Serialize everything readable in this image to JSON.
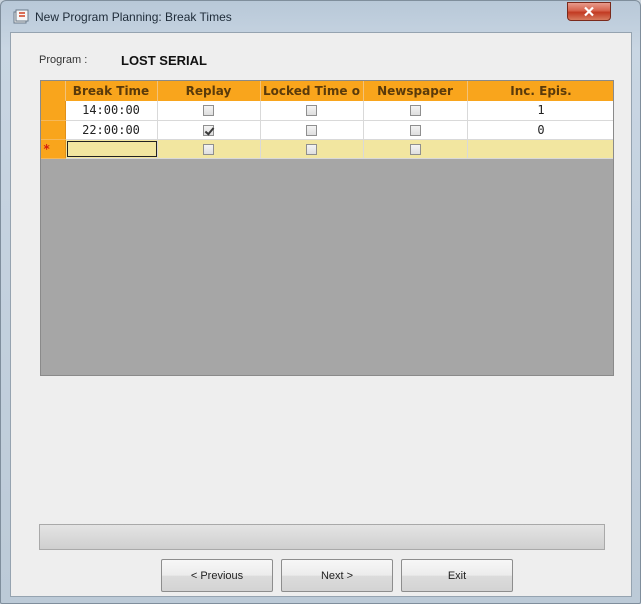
{
  "window": {
    "title": "New Program Planning: Break Times",
    "close_label": "x",
    "accent_color": "#f9a51c"
  },
  "program": {
    "label": "Program :",
    "value": "LOST SERIAL"
  },
  "grid": {
    "columns": [
      "Break Time",
      "Replay",
      "Locked Time o",
      "Newspaper",
      "Inc. Epis."
    ],
    "rows": [
      {
        "break_time": "14:00:00",
        "replay": false,
        "locked_time": false,
        "newspaper": false,
        "inc_epis": "1"
      },
      {
        "break_time": "22:00:00",
        "replay": true,
        "locked_time": false,
        "newspaper": false,
        "inc_epis": "0"
      }
    ],
    "new_row_marker": "*"
  },
  "buttons": {
    "previous": "< Previous",
    "next": "Next >",
    "exit": "Exit"
  }
}
